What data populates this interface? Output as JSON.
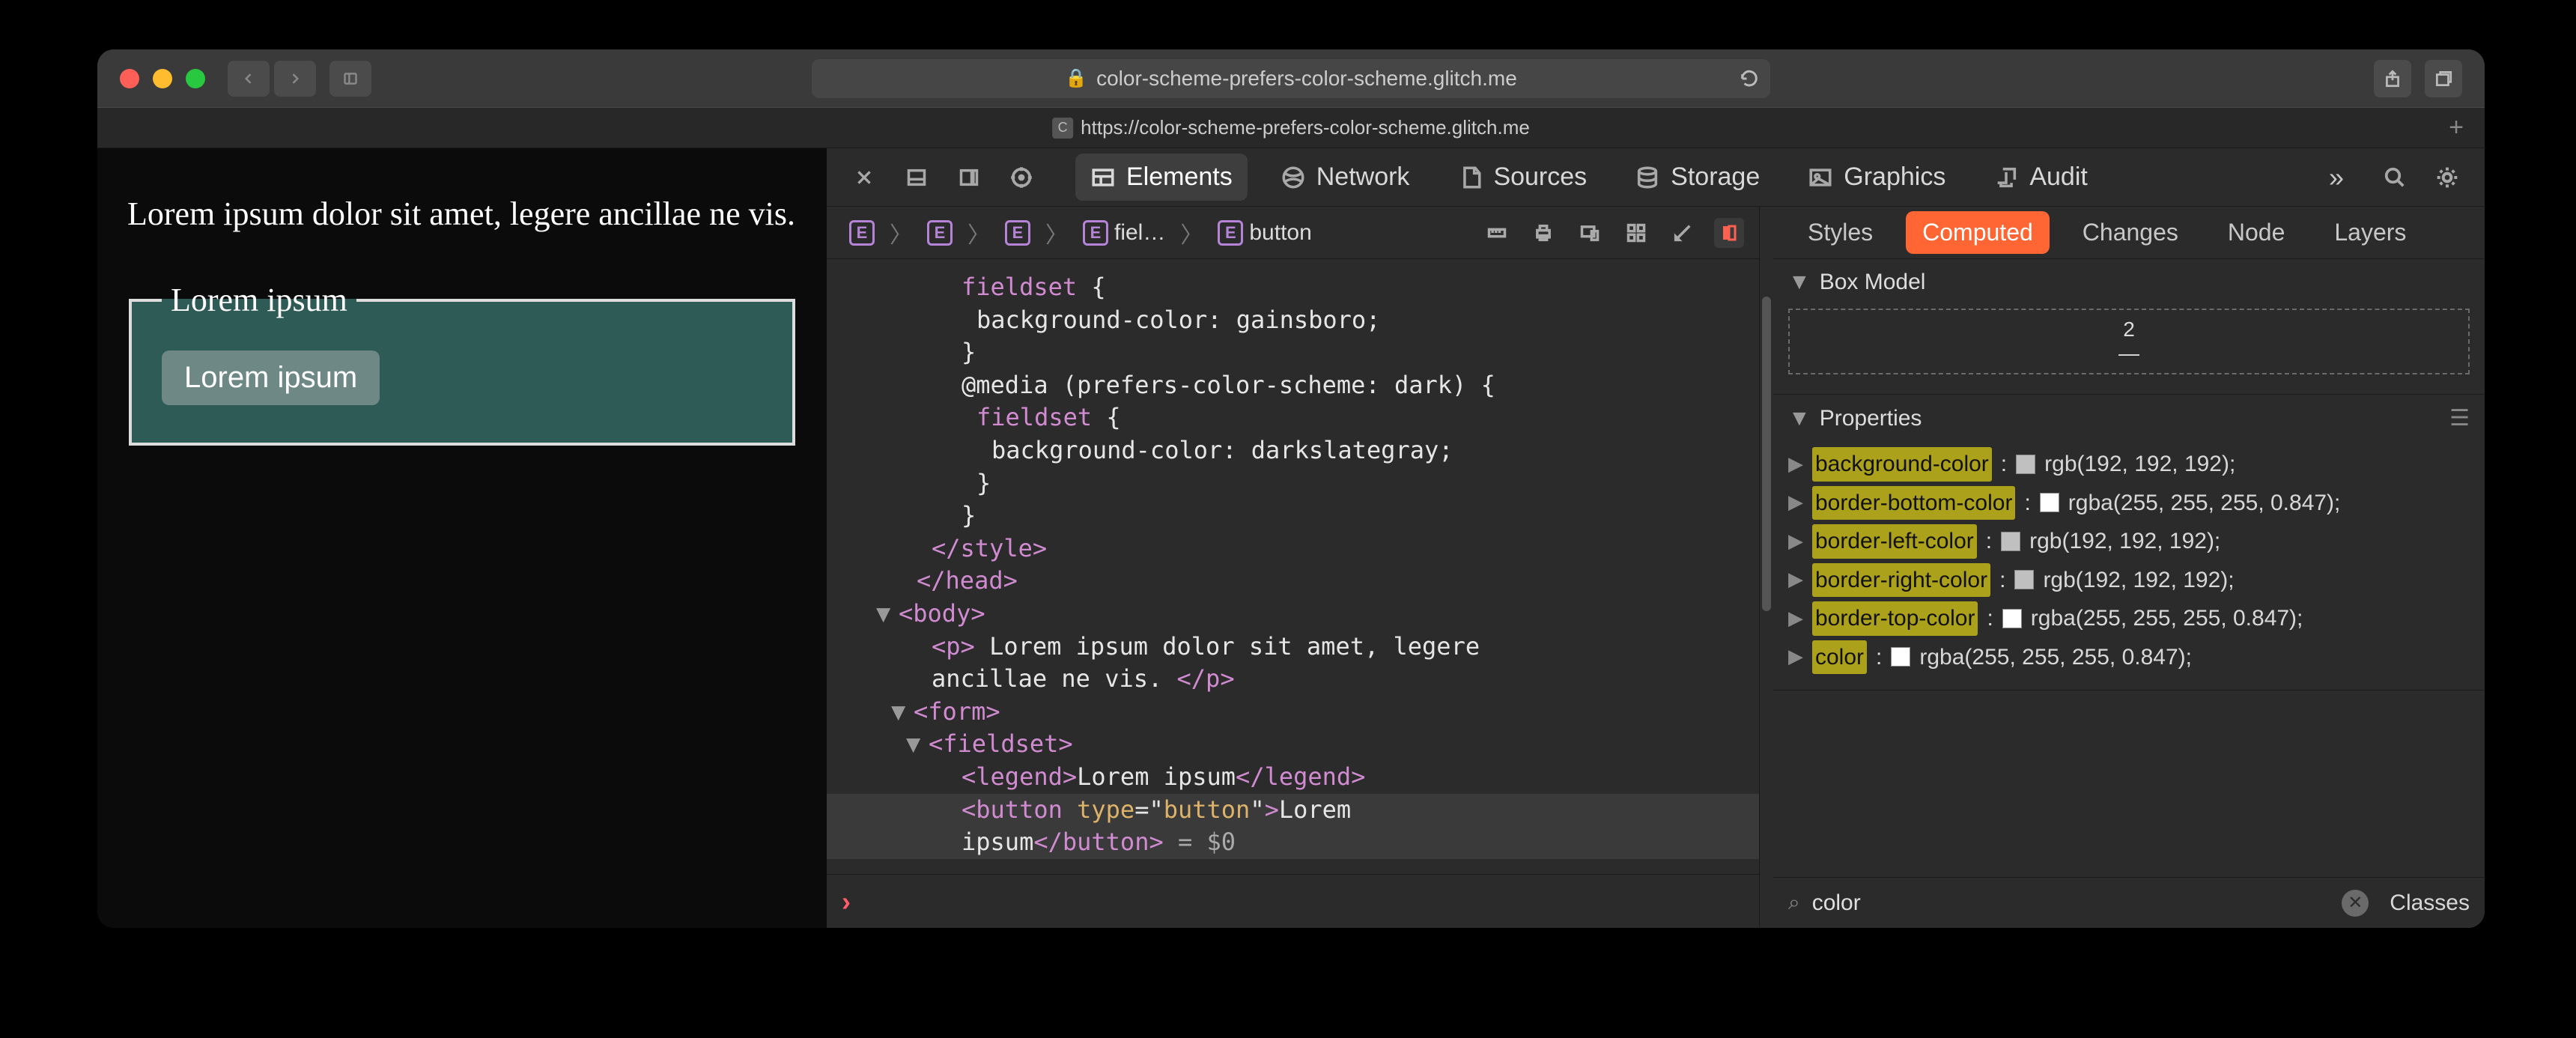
{
  "browser": {
    "url_display": "color-scheme-prefers-color-scheme.glitch.me",
    "tab_title": "https://color-scheme-prefers-color-scheme.glitch.me",
    "tab_favicon_letter": "C"
  },
  "page": {
    "paragraph": "Lorem ipsum dolor sit amet, legere ancillae ne vis.",
    "legend": "Lorem ipsum",
    "button": "Lorem ipsum"
  },
  "devtools": {
    "tabs": [
      "Elements",
      "Network",
      "Sources",
      "Storage",
      "Graphics",
      "Audit"
    ],
    "active_tab": "Elements",
    "breadcrumb": [
      "",
      "",
      "",
      "fiel…",
      "button"
    ],
    "code_lines": [
      {
        "indent": 120,
        "html": "<span class='tag'>fieldset</span> {"
      },
      {
        "indent": 140,
        "html": "background-color: gainsboro;"
      },
      {
        "indent": 120,
        "html": "}"
      },
      {
        "indent": 120,
        "html": "@media (prefers-color-scheme: dark) {"
      },
      {
        "indent": 140,
        "html": "<span class='tag'>fieldset</span> {"
      },
      {
        "indent": 160,
        "html": "background-color: darkslategray;"
      },
      {
        "indent": 140,
        "html": "}"
      },
      {
        "indent": 120,
        "html": "}"
      },
      {
        "indent": 80,
        "html": "<span class='tag'>&lt;/style&gt;</span>"
      },
      {
        "indent": 60,
        "html": "<span class='tag'>&lt;/head&gt;</span>"
      },
      {
        "indent": 40,
        "html": "<span class='twisty'>▼</span><span class='tag'>&lt;body&gt;</span>"
      },
      {
        "indent": 80,
        "html": "<span class='tag'>&lt;p&gt;</span> Lorem ipsum dolor sit amet, legere"
      },
      {
        "indent": 80,
        "html": "ancillae ne vis. <span class='tag'>&lt;/p&gt;</span>"
      },
      {
        "indent": 60,
        "html": "<span class='twisty'>▼</span><span class='tag'>&lt;form&gt;</span>"
      },
      {
        "indent": 80,
        "html": "<span class='twisty'>▼</span><span class='tag'>&lt;fieldset&gt;</span>"
      },
      {
        "indent": 120,
        "html": "<span class='tag'>&lt;legend&gt;</span>Lorem ipsum<span class='tag'>&lt;/legend&gt;</span>"
      },
      {
        "indent": 120,
        "sel": true,
        "html": "<span class='tag'>&lt;button </span><span class='attr'>type</span>=&quot;<span class='str'>button</span>&quot;<span class='tag'>&gt;</span>Lorem"
      },
      {
        "indent": 120,
        "sel": true,
        "html": "ipsum<span class='tag'>&lt;/button&gt;</span> <span class='dollar'>= $0</span>"
      }
    ],
    "more_glyph": "»"
  },
  "styles": {
    "tabs": [
      "Styles",
      "Computed",
      "Changes",
      "Node",
      "Layers"
    ],
    "active_tab": "Computed",
    "box_model_heading": "Box Model",
    "box_model_top": "2",
    "box_model_bottom": "—",
    "properties_heading": "Properties",
    "properties": [
      {
        "name": "background-color",
        "swatch": "#c0c0c0",
        "value": "rgb(192, 192, 192)"
      },
      {
        "name": "border-bottom-color",
        "swatch": "#ffffff",
        "value": "rgba(255, 255, 255, 0.847)"
      },
      {
        "name": "border-left-color",
        "swatch": "#c0c0c0",
        "value": "rgb(192, 192, 192)"
      },
      {
        "name": "border-right-color",
        "swatch": "#c0c0c0",
        "value": "rgb(192, 192, 192)"
      },
      {
        "name": "border-top-color",
        "swatch": "#ffffff",
        "value": "rgba(255, 255, 255, 0.847)"
      },
      {
        "name": "color",
        "swatch": "#ffffff",
        "value": "rgba(255, 255, 255, 0.847)"
      }
    ],
    "filter_value": "color",
    "classes_label": "Classes"
  }
}
